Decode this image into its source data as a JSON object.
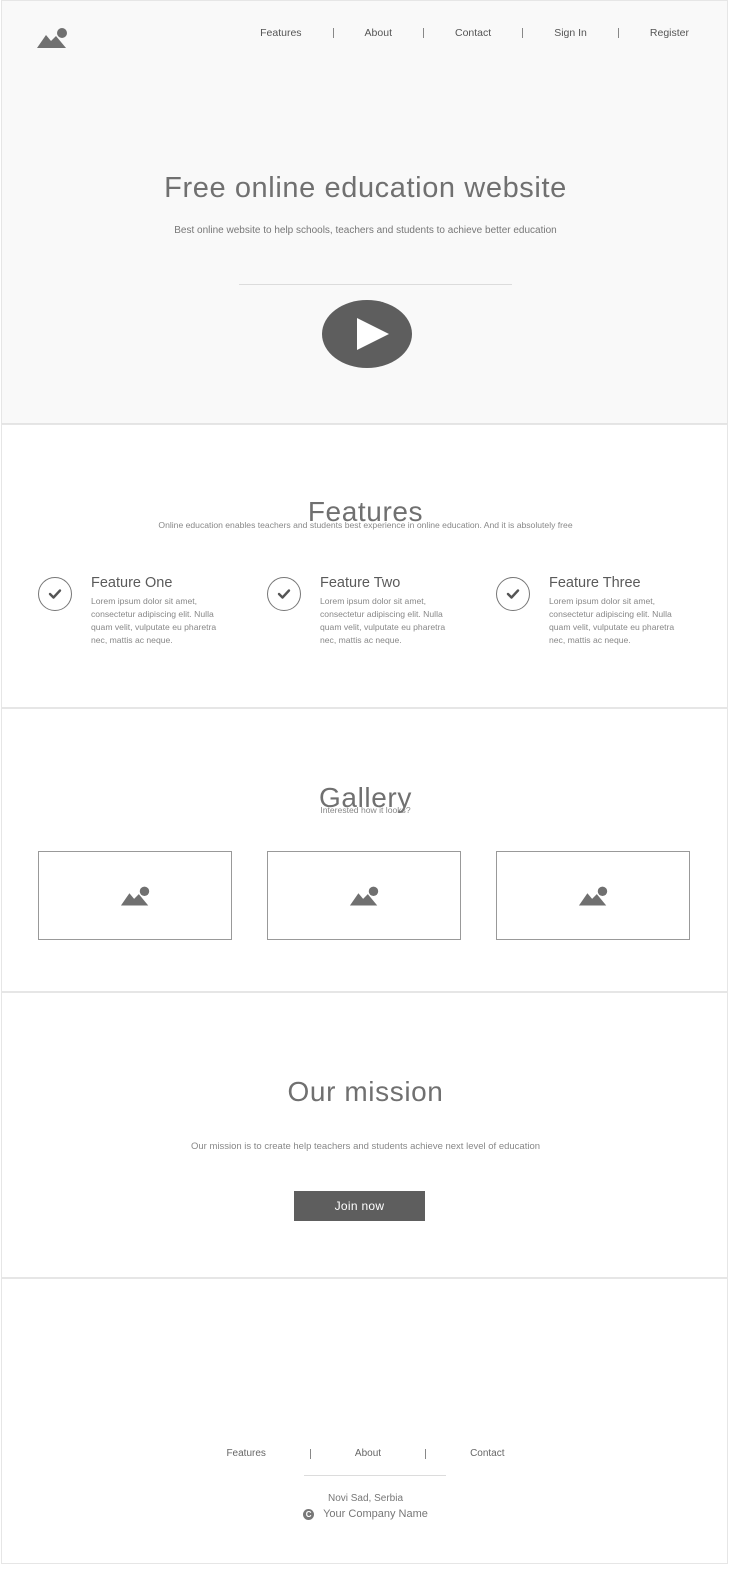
{
  "header": {
    "logo_icon": "image-placeholder-icon",
    "nav": [
      "Features",
      "About",
      "Contact",
      "Sign In",
      "Register"
    ]
  },
  "hero": {
    "title": "Free online education website",
    "subtitle": "Best online website to help schools, teachers and students to achieve better education",
    "video_icon": "play-icon"
  },
  "features": {
    "title": "Features",
    "subtitle": "Online education enables teachers and students best experience in online education. And it is absolutely free",
    "items": [
      {
        "title": "Feature One",
        "text": "Lorem ipsum dolor sit amet, consectetur adipiscing elit. Nulla quam velit, vulputate eu pharetra nec, mattis ac neque.",
        "icon": "check-icon"
      },
      {
        "title": "Feature Two",
        "text": "Lorem ipsum dolor sit amet, consectetur adipiscing elit. Nulla quam velit, vulputate eu pharetra nec, mattis ac neque.",
        "icon": "check-icon"
      },
      {
        "title": "Feature Three",
        "text": "Lorem ipsum dolor sit amet, consectetur adipiscing elit. Nulla quam velit, vulputate eu pharetra nec, mattis ac neque.",
        "icon": "check-icon"
      }
    ]
  },
  "gallery": {
    "title": "Gallery",
    "subtitle": "Interested how it looks?",
    "images": [
      "image-placeholder-icon",
      "image-placeholder-icon",
      "image-placeholder-icon"
    ]
  },
  "mission": {
    "title": "Our mission",
    "text": "Our mission is to create help teachers and students achieve next level of education",
    "button": "Join now"
  },
  "footer": {
    "nav": [
      "Features",
      "About",
      "Contact"
    ],
    "city": "Novi Sad, Serbia",
    "company": "Your Company Name",
    "copyright_symbol": "C"
  },
  "colors": {
    "dark_gray": "#5e5e5e",
    "hero_bg": "#f9f9f9"
  }
}
